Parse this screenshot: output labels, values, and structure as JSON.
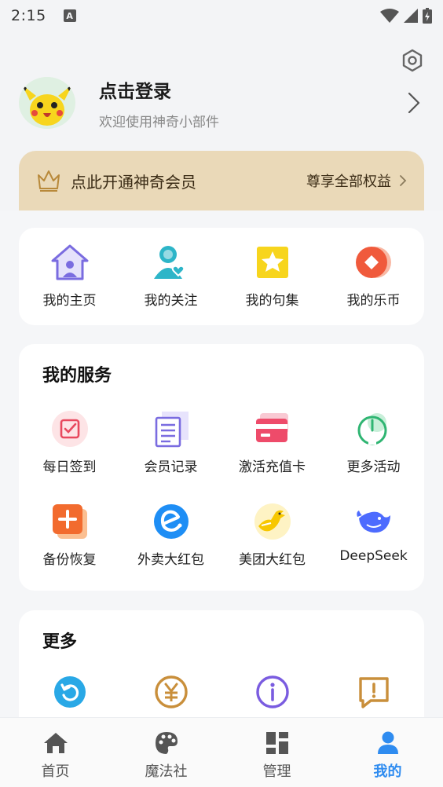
{
  "status_bar": {
    "time": "2:15",
    "notif_letter": "A"
  },
  "profile": {
    "title": "点击登录",
    "subtitle": "欢迎使用神奇小部件"
  },
  "vip": {
    "title": "点此开通神奇会员",
    "benefit": "尊享全部权益"
  },
  "quick_links": [
    {
      "label": "我的主页",
      "icon": "home-icon"
    },
    {
      "label": "我的关注",
      "icon": "follow-user-icon"
    },
    {
      "label": "我的句集",
      "icon": "star-icon"
    },
    {
      "label": "我的乐币",
      "icon": "coin-icon"
    }
  ],
  "services": {
    "title": "我的服务",
    "items": [
      {
        "label": "每日签到",
        "icon": "checkin-icon"
      },
      {
        "label": "会员记录",
        "icon": "record-icon"
      },
      {
        "label": "激活充值卡",
        "icon": "card-icon"
      },
      {
        "label": "更多活动",
        "icon": "activity-icon"
      },
      {
        "label": "备份恢复",
        "icon": "backup-icon"
      },
      {
        "label": "外卖大红包",
        "icon": "eleme-icon"
      },
      {
        "label": "美团大红包",
        "icon": "meituan-icon"
      },
      {
        "label": "DeepSeek",
        "icon": "deepseek-icon"
      }
    ]
  },
  "more": {
    "title": "更多",
    "items": [
      {
        "icon": "refresh-icon"
      },
      {
        "icon": "yuan-icon"
      },
      {
        "icon": "info-icon"
      },
      {
        "icon": "feedback-icon"
      }
    ]
  },
  "bottom_nav": [
    {
      "label": "首页",
      "icon": "home-nav-icon"
    },
    {
      "label": "魔法社",
      "icon": "palette-nav-icon"
    },
    {
      "label": "管理",
      "icon": "grid-nav-icon"
    },
    {
      "label": "我的",
      "icon": "person-nav-icon",
      "active": true
    }
  ],
  "colors": {
    "accent": "#2f8cf0",
    "vip_bg": "#ead9b8",
    "background": "#f5f6f8"
  }
}
